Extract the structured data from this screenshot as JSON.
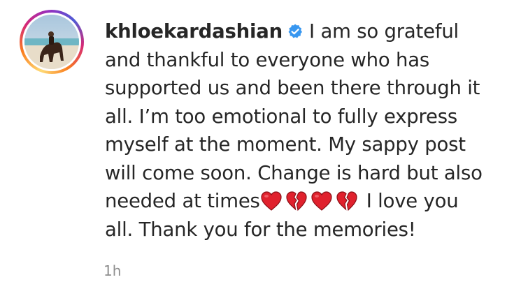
{
  "comment": {
    "username": "khloekardashian",
    "text_lines": [
      "I am so grateful",
      "and thankful to everyone who has",
      "supported us and been there through it",
      "all. I’m too emotional to fully express",
      "myself at the moment. My sappy post",
      "will come soon. Change is hard but also",
      "needed at times",
      "I love you",
      "all. Thank you for the memories!"
    ],
    "emoji": [
      "red-heart",
      "broken-heart",
      "red-heart",
      "broken-heart"
    ],
    "timestamp": "1h"
  },
  "colors": {
    "text": "#262626",
    "verified_blue": "#3897f0",
    "heart_red": "#e0212d",
    "timestamp_gray": "#8e8e8e"
  },
  "icons": {
    "verified": "verified-badge-icon",
    "heart": "red-heart-emoji",
    "broken_heart": "broken-heart-emoji"
  }
}
